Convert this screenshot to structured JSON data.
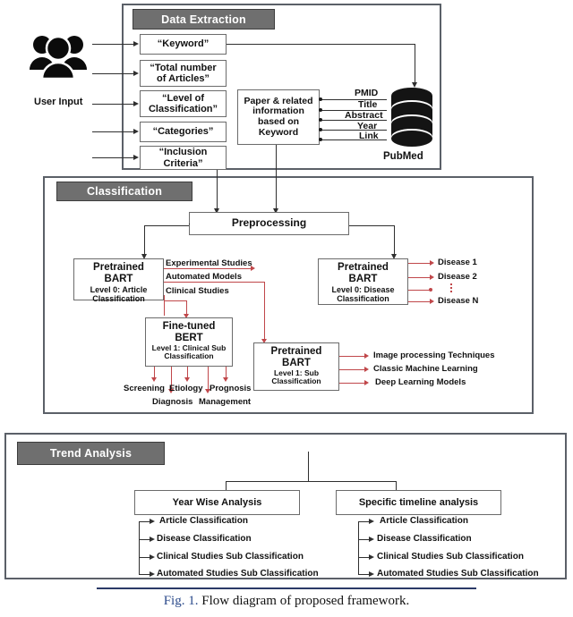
{
  "figure": {
    "caption_number": "Fig. 1.",
    "caption_text": " Flow diagram of proposed framework.",
    "accent_red": "#c0474a",
    "banner_grey": "#6f6f6f",
    "panel_border": "#5b6068",
    "caption_rule_color": "#2b3a67"
  },
  "user_input": {
    "icon": "users-group-icon",
    "label": "User Input"
  },
  "data_extraction": {
    "title": "Data Extraction",
    "inputs": [
      {
        "label": "“Keyword”"
      },
      {
        "label": "“Total number\nof Articles”"
      },
      {
        "label": "“Level of\nClassification”"
      },
      {
        "label": "“Categories”"
      },
      {
        "label": "“Inclusion\nCriteria”"
      }
    ],
    "paper_box": "Paper & related\ninformation\nbased on\nKeyword",
    "record_fields": [
      "PMID",
      "Title",
      "Abstract",
      "Year",
      "Link"
    ],
    "database": {
      "icon": "database-cylinder-icon",
      "label": "PubMed"
    }
  },
  "classification": {
    "title": "Classification",
    "preprocessing": "Preprocessing",
    "article_model": {
      "name": "Pretrained",
      "model": "BART",
      "level": "Level 0: Article",
      "level2": "Classification"
    },
    "article_outputs": [
      "Experimental Studies",
      "Automated Models",
      "Clinical Studies"
    ],
    "bert_model": {
      "name": "Fine-tuned",
      "model": "BERT",
      "level": "Level 1: Clinical Sub",
      "level2": "Classification"
    },
    "bert_outputs": [
      "Screening",
      "Diagnosis",
      "Etiology",
      "Management",
      "Prognosis"
    ],
    "disease_model": {
      "name": "Pretrained",
      "model": "BART",
      "level": "Level 0: Disease",
      "level2": "Classification"
    },
    "disease_outputs": [
      "Disease 1",
      "Disease 2",
      "Disease N"
    ],
    "sub_model": {
      "name": "Pretrained",
      "model": "BART",
      "level": "Level 1: Sub",
      "level2": "Classification"
    },
    "sub_outputs": [
      "Image  processing Techniques",
      "Classic Machine Learning",
      "Deep Learning Models"
    ]
  },
  "trend_analysis": {
    "title": "Trend Analysis",
    "branches": [
      {
        "title": "Year Wise Analysis",
        "items": [
          "Article Classification",
          "Disease Classification",
          "Clinical Studies Sub  Classification",
          "Automated Studies Sub Classification"
        ]
      },
      {
        "title": "Specific timeline analysis",
        "items": [
          "Article Classification",
          "Disease Classification",
          "Clinical Studies Sub  Classification",
          "Automated Studies Sub Classification"
        ]
      }
    ]
  }
}
